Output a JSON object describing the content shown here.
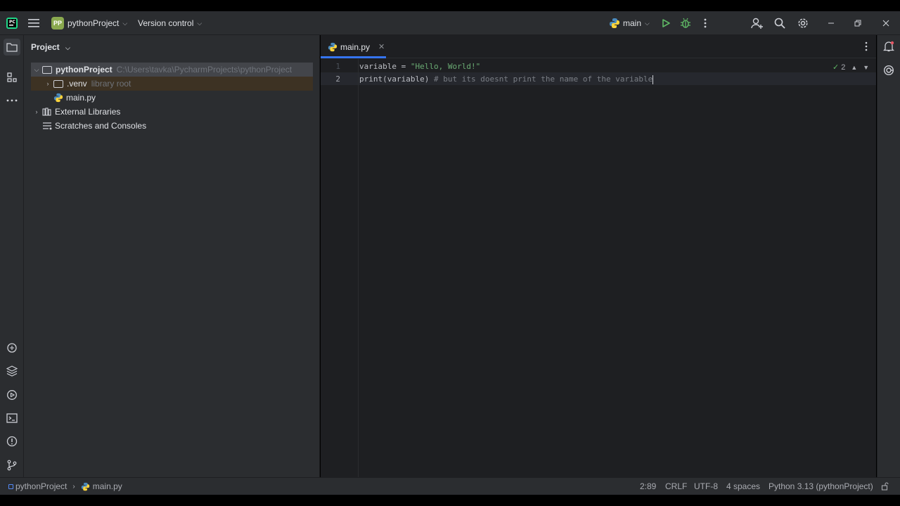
{
  "titlebar": {
    "project_badge": "PP",
    "project_name": "pythonProject",
    "vcs_label": "Version control",
    "branch_label": "main"
  },
  "project_panel": {
    "title": "Project",
    "tree": {
      "root_name": "pythonProject",
      "root_path": "C:\\Users\\tavka\\PycharmProjects\\pythonProject",
      "venv_name": ".venv",
      "venv_hint": "library root",
      "file_name": "main.py",
      "external_libraries": "External Libraries",
      "scratches": "Scratches and Consoles"
    }
  },
  "editor": {
    "tab_label": "main.py",
    "inspection_count": "2",
    "line_numbers": [
      "1",
      "2"
    ],
    "line1": {
      "var": "variable",
      "eq": " = ",
      "str": "\"Hello, World!\""
    },
    "line2": {
      "fn": "print",
      "args": "(variable)",
      "comment": " # but its doesnt print the name of the variable"
    }
  },
  "statusbar": {
    "breadcrumb_project": "pythonProject",
    "breadcrumb_file": "main.py",
    "position": "2:89",
    "line_sep": "CRLF",
    "encoding": "UTF-8",
    "indent": "4 spaces",
    "interpreter": "Python 3.13 (pythonProject)"
  },
  "colors": {
    "accent": "#3574f0",
    "string": "#6aab73",
    "comment": "#7a7e85",
    "run": "#5fb865",
    "debug": "#5fb865"
  }
}
